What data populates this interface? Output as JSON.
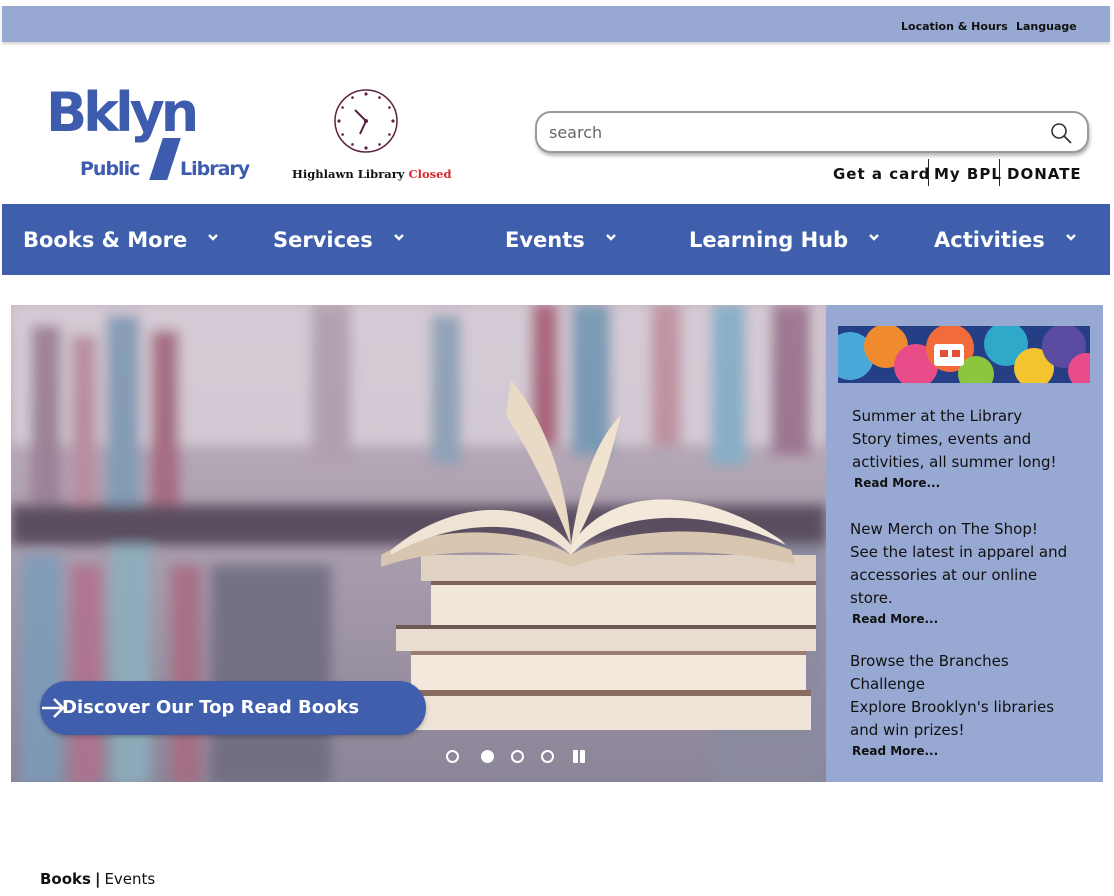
{
  "topbar": {
    "location_hours": "Location & Hours",
    "language": "Language",
    "background": "#97a9d3"
  },
  "logo": {
    "line1": "Bklyn",
    "line2a": "Public",
    "line2b": "Library",
    "color": "#3d5cad"
  },
  "clock": {
    "branch": "Highlawn Library",
    "status": "Closed",
    "status_color": "#d8262b"
  },
  "search": {
    "placeholder": "search",
    "icon": "search-icon"
  },
  "account_links": {
    "get_card": "Get a card",
    "my_bpl": "My BPL",
    "donate": "DONATE",
    "donate_color": "#e0262b"
  },
  "nav": {
    "background": "#3f5fac",
    "items": [
      {
        "label": "Books & More"
      },
      {
        "label": "Services"
      },
      {
        "label": "Events"
      },
      {
        "label": "Learning Hub"
      },
      {
        "label": "Activities"
      }
    ]
  },
  "hero": {
    "cta_label": "Discover Our Top Read Books",
    "carousel": {
      "slide_count": 4,
      "active_slide": 2
    }
  },
  "sidebar": {
    "background": "#97a9d3",
    "news": [
      {
        "title": "Summer at the Library",
        "body": "Story times, events and activities, all summer long!",
        "link": "Read More..."
      },
      {
        "title": "New Merch on The Shop!",
        "body": "See the latest in apparel and accessories at our online store.",
        "link": "Read More..."
      },
      {
        "title": "Browse the Branches Challenge",
        "body": "Explore Brooklyn's libraries and win prizes!",
        "link": "Read More..."
      }
    ]
  },
  "bottom_tabs": {
    "books": "Books",
    "separator": "|",
    "events": "Events"
  }
}
